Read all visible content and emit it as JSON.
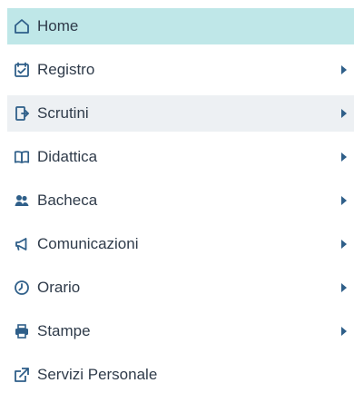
{
  "colors": {
    "active_background": "#bfe7e8",
    "hover_background": "#edf0f3",
    "text": "#2f3b4a",
    "icon": "#2f5f89"
  },
  "menu": {
    "items": [
      {
        "label": "Home",
        "icon": "home-icon"
      },
      {
        "label": "Registro",
        "icon": "calendar-check-icon"
      },
      {
        "label": "Scrutini",
        "icon": "exit-door-icon"
      },
      {
        "label": "Didattica",
        "icon": "open-book-icon"
      },
      {
        "label": "Bacheca",
        "icon": "group-icon"
      },
      {
        "label": "Comunicazioni",
        "icon": "megaphone-icon"
      },
      {
        "label": "Orario",
        "icon": "clock-icon"
      },
      {
        "label": "Stampe",
        "icon": "printer-icon"
      },
      {
        "label": "Servizi Personale",
        "icon": "external-link-icon"
      }
    ]
  }
}
